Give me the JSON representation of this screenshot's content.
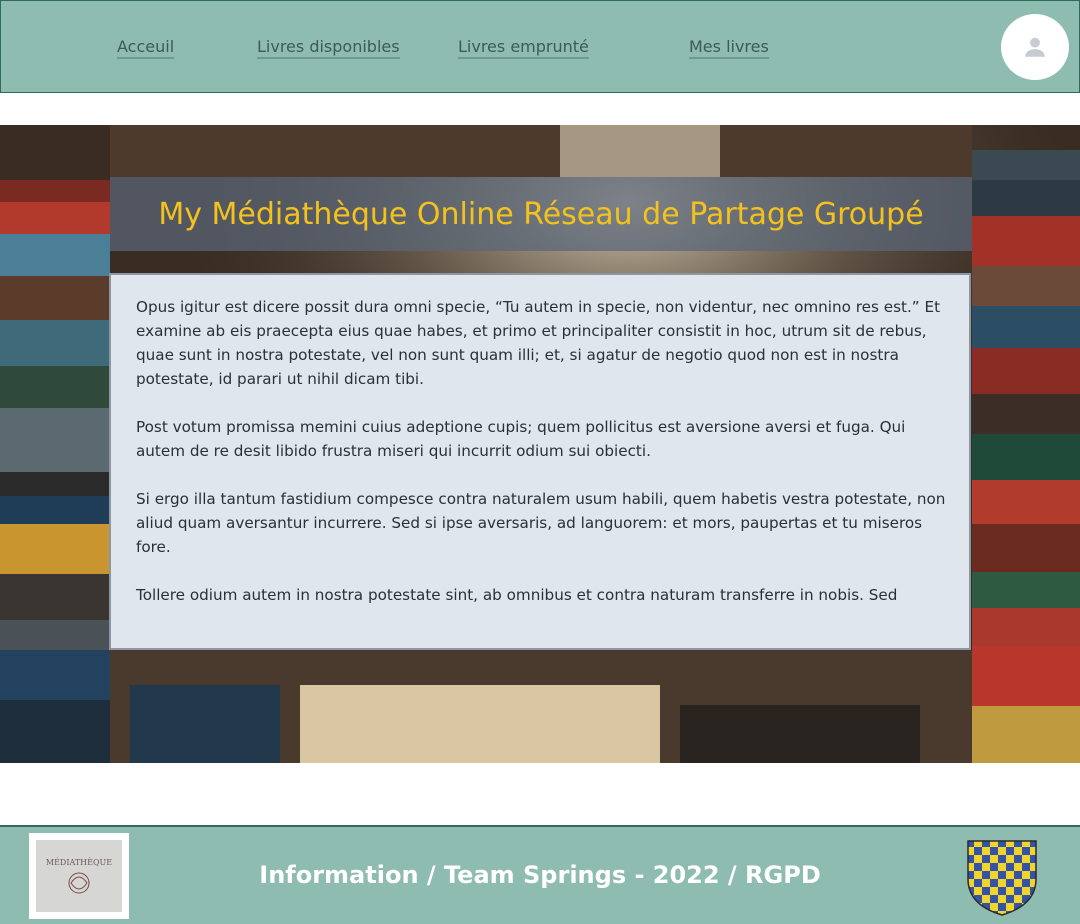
{
  "nav": {
    "links": [
      {
        "label": "Acceuil"
      },
      {
        "label": "Livres disponibles"
      },
      {
        "label": "Livres emprunté"
      },
      {
        "label": "Mes livres"
      }
    ],
    "avatar_icon": "user-icon"
  },
  "hero": {
    "title": "My Médiathèque Online Réseau de Partage Groupé",
    "paragraphs": [
      "Opus igitur est dicere possit dura omni specie, “Tu autem in specie, non videntur, nec omnino res est.” Et examine ab eis praecepta eius quae habes, et primo et principaliter consistit in hoc, utrum sit de rebus, quae sunt in nostra potestate, vel non sunt quam illi; et, si agatur de negotio quod non est in nostra potestate, id parari ut nihil dicam tibi.",
      "Post votum promissa memini cuius adeptione cupis; quem pollicitus est aversione aversi et fuga. Qui autem de re desit libido frustra miseri qui incurrit odium sui obiecti.",
      "Si ergo illa tantum fastidium compesce contra naturalem usum habili, quem habetis vestra potestate, non aliud quam aversantur incurrere. Sed si ipse aversaris, ad languorem: et mors, paupertas et tu miseros fore.",
      "Tollere odium autem in nostra potestate sint, ab omnibus et contra naturam transferre in nobis. Sed"
    ]
  },
  "footer": {
    "text": "Information / Team Springs - 2022 / RGPD",
    "logo_text": "MÉDIATHÈQUE",
    "crest_icon": "coat-of-arms-icon"
  },
  "colors": {
    "header_bg": "#8fbcb0",
    "title_color": "#f3c21c",
    "panel_bg": "#e0e6ee"
  }
}
